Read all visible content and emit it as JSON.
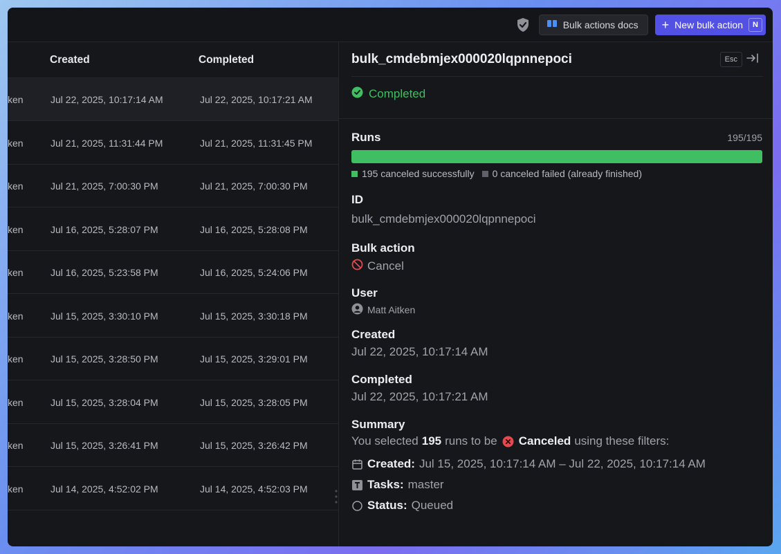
{
  "toolbar": {
    "docs_label": "Bulk actions docs",
    "new_label": "New bulk action",
    "new_shortcut": "N"
  },
  "table": {
    "columns": [
      "Created",
      "Completed"
    ],
    "rows": [
      {
        "user": "ken",
        "created": "Jul 22, 2025, 10:17:14 AM",
        "completed": "Jul 22, 2025, 10:17:21 AM"
      },
      {
        "user": "ken",
        "created": "Jul 21, 2025, 11:31:44 PM",
        "completed": "Jul 21, 2025, 11:31:45 PM"
      },
      {
        "user": "ken",
        "created": "Jul 21, 2025, 7:00:30 PM",
        "completed": "Jul 21, 2025, 7:00:30 PM"
      },
      {
        "user": "ken",
        "created": "Jul 16, 2025, 5:28:07 PM",
        "completed": "Jul 16, 2025, 5:28:08 PM"
      },
      {
        "user": "ken",
        "created": "Jul 16, 2025, 5:23:58 PM",
        "completed": "Jul 16, 2025, 5:24:06 PM"
      },
      {
        "user": "ken",
        "created": "Jul 15, 2025, 3:30:10 PM",
        "completed": "Jul 15, 2025, 3:30:18 PM"
      },
      {
        "user": "ken",
        "created": "Jul 15, 2025, 3:28:50 PM",
        "completed": "Jul 15, 2025, 3:29:01 PM"
      },
      {
        "user": "ken",
        "created": "Jul 15, 2025, 3:28:04 PM",
        "completed": "Jul 15, 2025, 3:28:05 PM"
      },
      {
        "user": "ken",
        "created": "Jul 15, 2025, 3:26:41 PM",
        "completed": "Jul 15, 2025, 3:26:42 PM"
      },
      {
        "user": "ken",
        "created": "Jul 14, 2025, 4:52:02 PM",
        "completed": "Jul 14, 2025, 4:52:03 PM"
      }
    ]
  },
  "panel": {
    "title": "bulk_cmdebmjex000020lqpnnepoci",
    "esc_label": "Esc",
    "status": "Completed",
    "runs_label": "Runs",
    "runs_count": "195/195",
    "runs_progress": 1.0,
    "legend_success": "195 canceled successfully",
    "legend_failed": "0 canceled failed (already finished)",
    "id_label": "ID",
    "id_value": "bulk_cmdebmjex000020lqpnnepoci",
    "action_label": "Bulk action",
    "action_value": "Cancel",
    "user_label": "User",
    "user_value": "Matt Aitken",
    "created_label": "Created",
    "created_value": "Jul 22, 2025, 10:17:14 AM",
    "completed_label": "Completed",
    "completed_value": "Jul 22, 2025, 10:17:21 AM",
    "summary_label": "Summary",
    "summary_prefix": "You selected",
    "summary_count": "195",
    "summary_mid": "runs to be",
    "summary_action": "Canceled",
    "summary_suffix": "using these filters:",
    "filters": [
      {
        "key": "Created:",
        "value": "Jul 15, 2025, 10:17:14 AM – Jul 22, 2025, 10:17:14 AM",
        "icon": "calendar-icon"
      },
      {
        "key": "Tasks:",
        "value": "master",
        "icon": "task-icon"
      },
      {
        "key": "Status:",
        "value": "Queued",
        "icon": "circle-status-icon"
      }
    ]
  },
  "colors": {
    "accent": "#5350e6",
    "success": "#3fbe62",
    "danger": "#e5484d"
  }
}
